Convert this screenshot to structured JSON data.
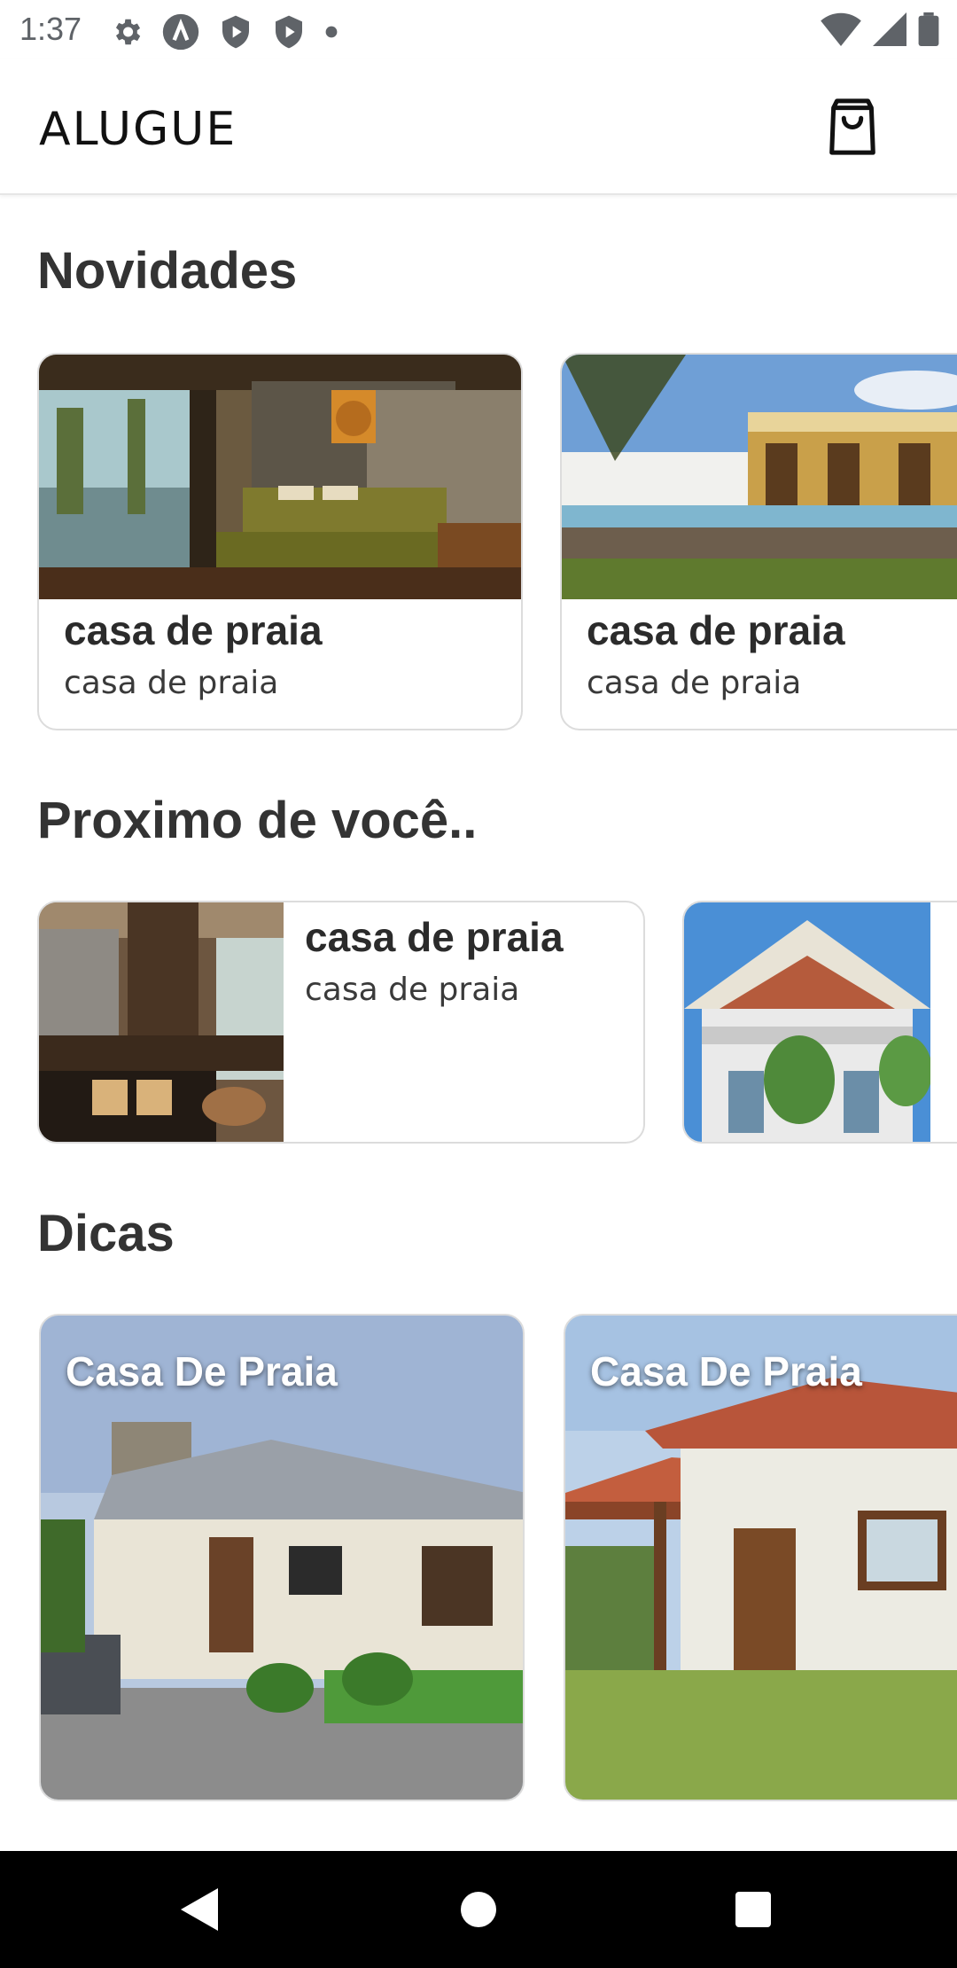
{
  "status_bar": {
    "time": "1:37",
    "left_icons": [
      "gear-icon",
      "a-circle-icon",
      "shield-play-icon",
      "shield-play-icon",
      "dot-icon"
    ],
    "right_icons": [
      "wifi-icon",
      "signal-icon",
      "battery-icon"
    ]
  },
  "app_bar": {
    "title": "ALUGUE",
    "cart_icon": "shopping-bag-icon"
  },
  "sections": {
    "novidades": {
      "title": "Novidades",
      "cards": [
        {
          "title": "casa de praia",
          "subtitle": "casa de praia"
        },
        {
          "title": "casa de praia",
          "subtitle": "casa de praia"
        }
      ]
    },
    "proximo": {
      "title": "Proximo de você..",
      "cards": [
        {
          "title": "casa de praia",
          "subtitle": "casa de praia"
        }
      ]
    },
    "dicas": {
      "title": "Dicas",
      "cards": [
        {
          "label": "Casa De Praia"
        },
        {
          "label": "Casa De Praia"
        }
      ]
    }
  },
  "nav_bar": {
    "icons": [
      "back-icon",
      "home-icon",
      "recents-icon"
    ]
  },
  "colors": {
    "accent_text": "#333333",
    "card_border": "#dcdcdc",
    "nav_background": "#000000"
  }
}
